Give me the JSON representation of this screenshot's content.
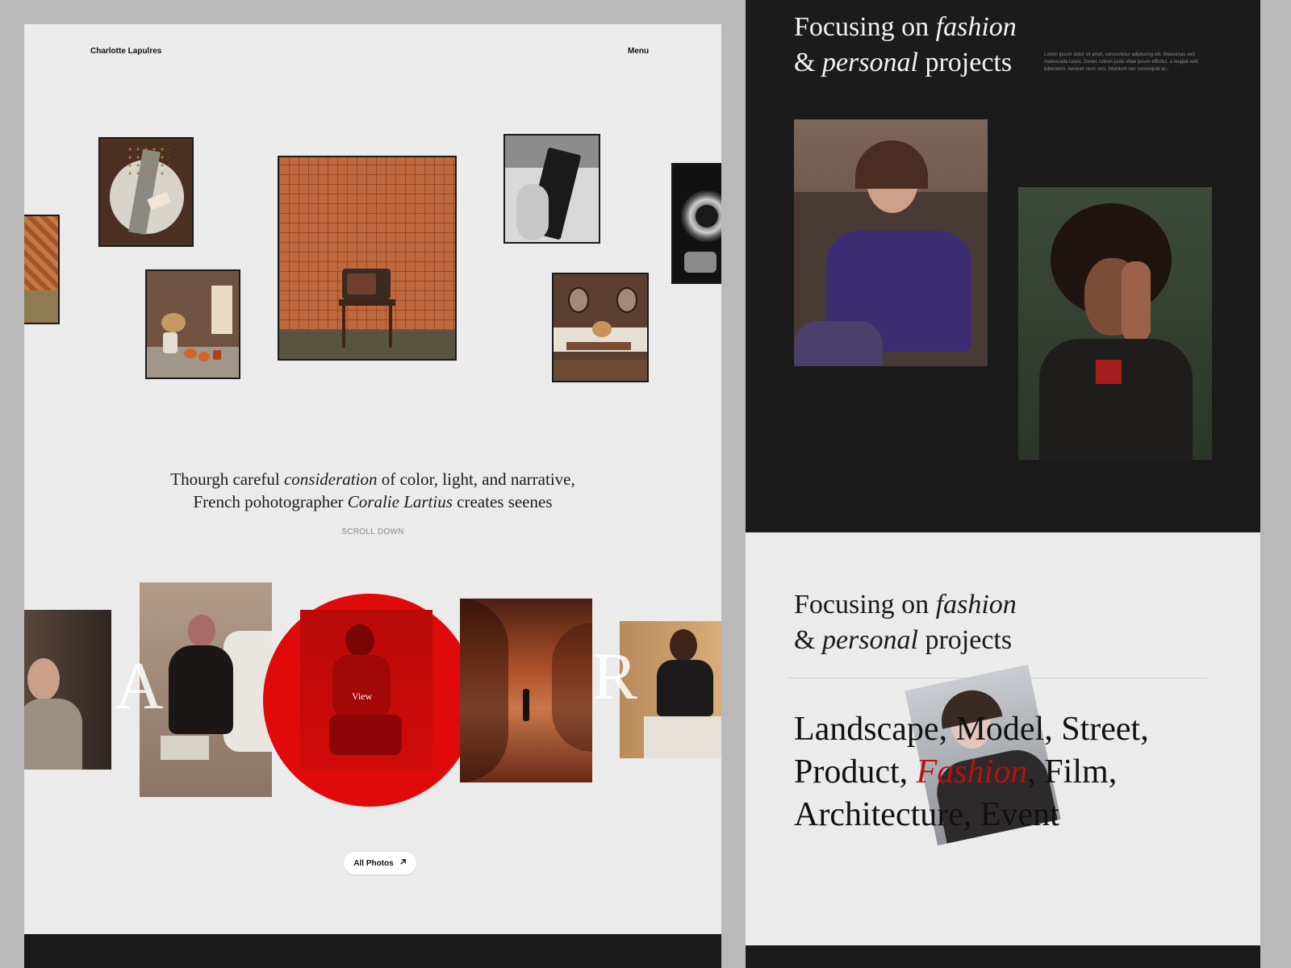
{
  "left": {
    "brand": "Charlotte Lapulres",
    "menu_label": "Menu",
    "hero": {
      "line1_a": "Thourgh careful ",
      "line1_em": "consideration",
      "line1_b": " of color, light, and narrative,",
      "line2_a": "French pohotographer ",
      "line2_em": "Coralie Lartius",
      "line2_b": " creates seenes"
    },
    "scroll_label": "SCROLL DOWN",
    "ghost_letters": [
      "A",
      "R"
    ],
    "view_label": "View",
    "all_photos_label": "All Photos",
    "gallery_top": [
      {
        "name": "wallpaper-photo"
      },
      {
        "name": "place-setting-photo"
      },
      {
        "name": "still-life-table-photo"
      },
      {
        "name": "retro-tv-photo"
      },
      {
        "name": "vhs-tape-photo"
      },
      {
        "name": "dining-room-photo"
      },
      {
        "name": "vintage-camera-photo"
      }
    ],
    "gallery_bottom": [
      {
        "name": "portrait-woman-photo"
      },
      {
        "name": "woman-on-bed-photo"
      },
      {
        "name": "red-portrait-photo"
      },
      {
        "name": "canyon-photo"
      },
      {
        "name": "young-man-photo"
      }
    ]
  },
  "right": {
    "dark": {
      "heading_a": "Focusing on ",
      "heading_em1": "fashion",
      "heading_b": "& ",
      "heading_em2": "personal",
      "heading_c": " projects",
      "lorem": "Lorem ipsum dolor sit amet, consectetur adipiscing elit. Maecenas sed malesuada turpis. Donec rutrum justo vitae ipsum efficitur, a feugiat velit bibendum. Aenean nunc orci, interdum nec consequat ac.."
    },
    "light": {
      "heading_a": "Focusing on ",
      "heading_em1": "fashion",
      "heading_b": "& ",
      "heading_em2": "personal",
      "heading_c": " projects",
      "cat1": "Landscape, Model, Street,",
      "cat2_a": "Product, ",
      "cat2_hl": "Fashion",
      "cat2_b": ", Film,",
      "cat3": "Architecture, Event"
    }
  },
  "colors": {
    "accent_red": "#e10a0a",
    "highlight_red": "#b31212",
    "dark_bg": "#1b1b1b",
    "light_bg": "#ebebeb"
  },
  "icons": {
    "arrow": "arrow-up-right-icon"
  }
}
